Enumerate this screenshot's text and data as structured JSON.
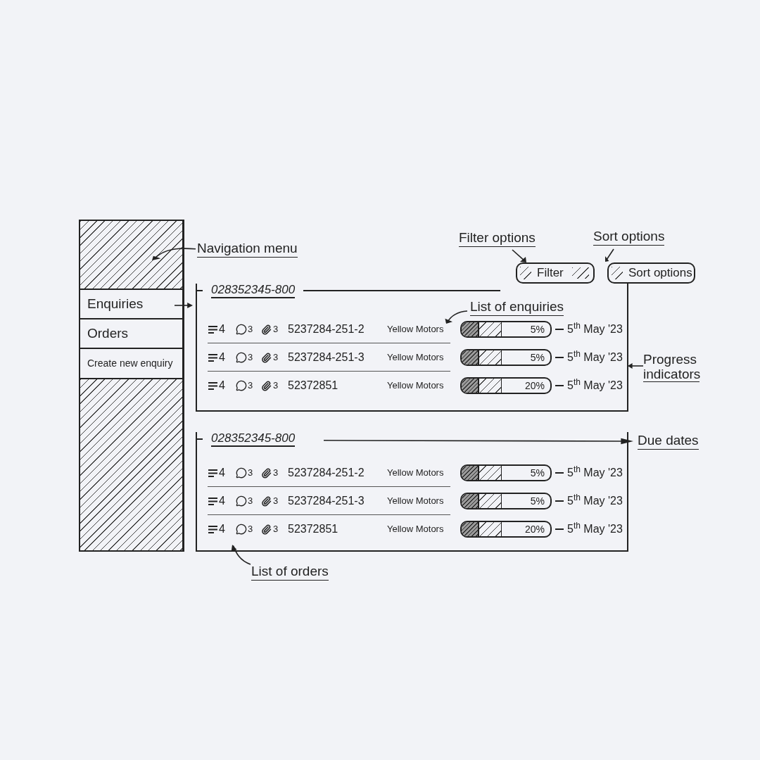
{
  "annotations": {
    "navigation_menu": "Navigation menu",
    "filter_options": "Filter options",
    "sort_options": "Sort options",
    "list_of_enquiries": "List of enquiries",
    "progress_indicators": "Progress indicators",
    "due_dates": "Due dates",
    "list_of_orders": "List of orders"
  },
  "sidebar": {
    "items": [
      "Enquiries",
      "Orders",
      "Create new enquiry"
    ]
  },
  "toolbar": {
    "buttons": [
      "Filter",
      "Sort options"
    ]
  },
  "lists": [
    {
      "title": "028352345-800",
      "rows": [
        {
          "lines": "4",
          "comments": "3",
          "attachments": "3",
          "number": "5237284-251-2",
          "company": "Yellow Motors",
          "progress": "5%",
          "due": "5$^{th}$ May '23"
        },
        {
          "lines": "4",
          "comments": "3",
          "attachments": "3",
          "number": "5237284-251-3",
          "company": "Yellow Motors",
          "progress": "5%",
          "due": "5$^{th}$ May '23"
        },
        {
          "lines": "4",
          "comments": "3",
          "attachments": "3",
          "number": "52372851",
          "company": "Yellow Motors",
          "progress": "20%",
          "due": "5$^{th}$ May '23"
        }
      ]
    },
    {
      "title": "028352345-800",
      "rows": [
        {
          "lines": "4",
          "comments": "3",
          "attachments": "3",
          "number": "5237284-251-2",
          "company": "Yellow Motors",
          "progress": "5%",
          "due": "5$^{th}$ May '23"
        },
        {
          "lines": "4",
          "comments": "3",
          "attachments": "3",
          "number": "5237284-251-3",
          "company": "Yellow Motors",
          "progress": "5%",
          "due": "5$^{th}$ May '23"
        },
        {
          "lines": "4",
          "comments": "3",
          "attachments": "3",
          "number": "52372851",
          "company": "Yellow Motors",
          "progress": "20%",
          "due": "5$^{th}$ May '23"
        }
      ]
    }
  ]
}
